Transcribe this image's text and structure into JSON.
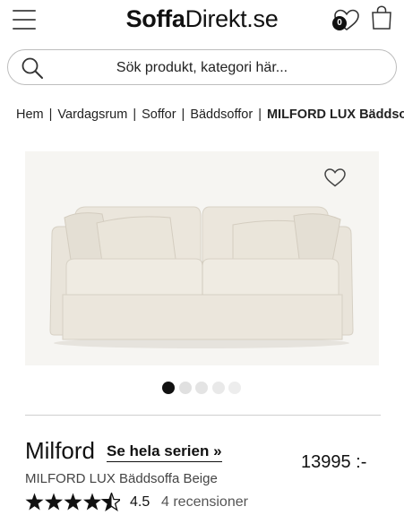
{
  "header": {
    "logo_bold": "Soffa",
    "logo_light": "Direkt.se",
    "wishlist_count": "0",
    "icons": [
      "hamburger-menu-icon",
      "heart-icon",
      "shopping-bag-icon"
    ]
  },
  "search": {
    "placeholder": "Sök produkt, kategori här..."
  },
  "breadcrumb": {
    "items": [
      "Hem",
      "Vardagsrum",
      "Soffor",
      "Bäddsoffor"
    ],
    "current": "MILFORD LUX Bäddsoffa Beige"
  },
  "gallery": {
    "dot_count": 5,
    "active_index": 0,
    "active_color": "#111111",
    "inactive_color": "#dcdcdc"
  },
  "product": {
    "name": "Milford",
    "series_link": "Se hela serien »",
    "subtitle": "MILFORD LUX Bäddsoffa Beige",
    "price": "13995 :-",
    "rating": "4.5",
    "rating_value": 4.5,
    "rating_max": 5,
    "reviews": "4 recensioner"
  }
}
